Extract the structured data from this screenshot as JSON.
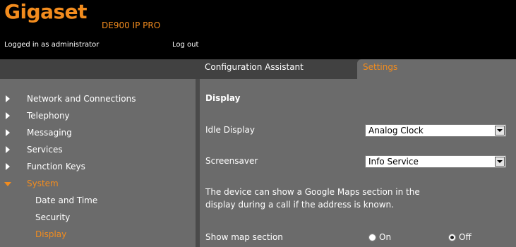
{
  "header": {
    "brand": "Gigaset",
    "model": "DE900 IP PRO",
    "login_status": "Logged in as administrator",
    "logout_label": "Log out",
    "accent_color": "#f28c1e"
  },
  "tabs": [
    {
      "label": "Configuration Assistant",
      "active": false
    },
    {
      "label": "Settings",
      "active": true
    }
  ],
  "sidebar": {
    "items": [
      {
        "label": "Network and Connections",
        "icon": "chevron-right-icon"
      },
      {
        "label": "Telephony",
        "icon": "chevron-right-icon"
      },
      {
        "label": "Messaging",
        "icon": "chevron-right-icon"
      },
      {
        "label": "Services",
        "icon": "chevron-right-icon"
      },
      {
        "label": "Function Keys",
        "icon": "chevron-right-icon"
      },
      {
        "label": "System",
        "icon": "chevron-down-icon",
        "expanded": true
      }
    ],
    "subitems": [
      {
        "label": "Date and Time"
      },
      {
        "label": "Security"
      },
      {
        "label": "Display",
        "active": true
      }
    ]
  },
  "main": {
    "section_title": "Display",
    "idle_display": {
      "label": "Idle Display",
      "value": "Analog Clock"
    },
    "screensaver": {
      "label": "Screensaver",
      "value": "Info Service"
    },
    "info_text": "The device can show a Google Maps section in the display during a call if the address is known.",
    "show_map": {
      "label": "Show map section",
      "option_on": "On",
      "option_off": "Off",
      "selected": "Off"
    }
  }
}
